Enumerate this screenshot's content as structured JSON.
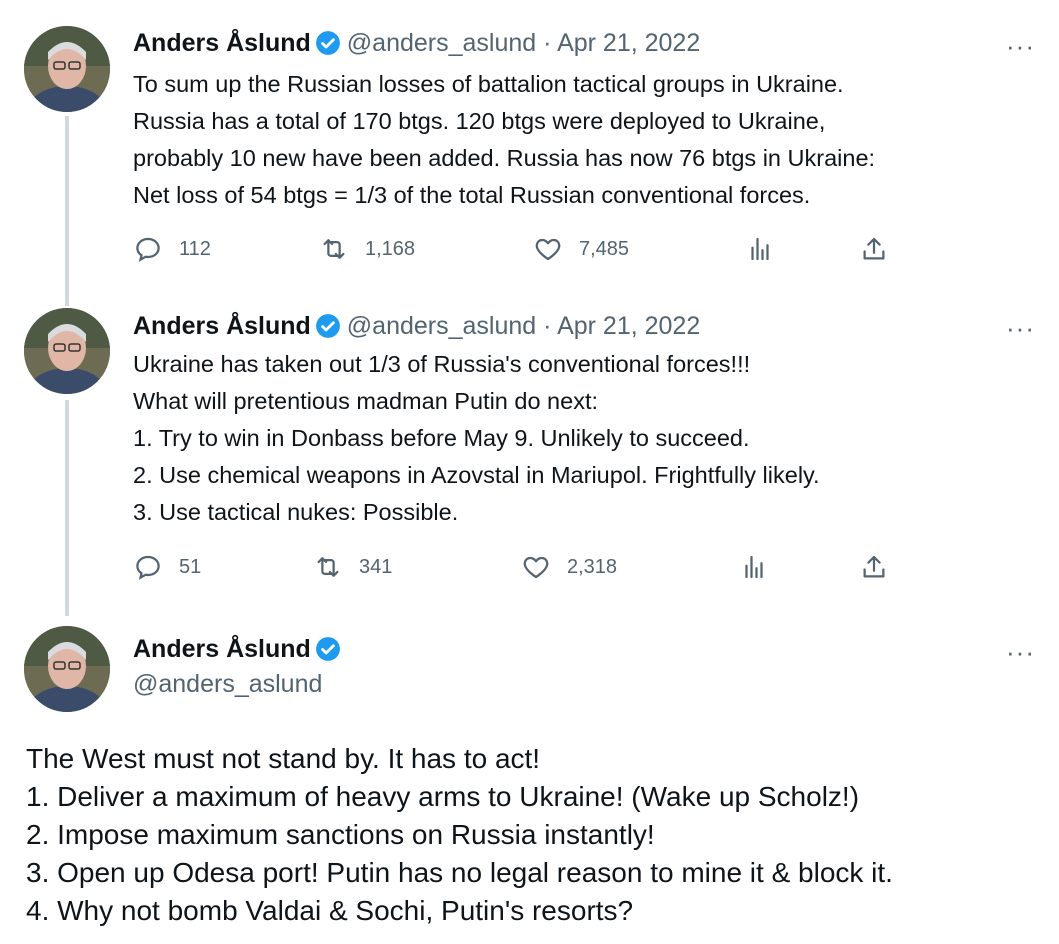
{
  "colors": {
    "text": "#0f1419",
    "secondary": "#536471",
    "verified": "#1d9bf0",
    "thread_line": "#cfd9de"
  },
  "tweets": [
    {
      "name": "Anders Åslund",
      "handle": "@anders_aslund",
      "separator": "·",
      "date": "Apr 21, 2022",
      "more": "···",
      "text": "To sum up the Russian losses of battalion tactical groups in Ukraine.\nRussia has a total of 170 btgs. 120 btgs were deployed to Ukraine,\nprobably 10 new have been added. Russia has now 76 btgs in Ukraine:\nNet loss of 54 btgs = 1/3 of the total Russian conventional forces.",
      "replies": "112",
      "retweets": "1,168",
      "likes": "7,485"
    },
    {
      "name": "Anders Åslund",
      "handle": "@anders_aslund",
      "separator": "·",
      "date": "Apr 21, 2022",
      "more": "···",
      "text": "Ukraine has taken out 1/3 of Russia's conventional forces!!!\nWhat will pretentious madman Putin do next:\n1. Try to win in Donbass before May 9. Unlikely to succeed.\n2. Use chemical weapons in Azovstal in Mariupol. Frightfully likely.\n3. Use tactical nukes: Possible.",
      "replies": "51",
      "retweets": "341",
      "likes": "2,318"
    },
    {
      "name": "Anders Åslund",
      "handle": "@anders_aslund",
      "more": "···",
      "text": "The West must not stand by. It has to act!\n1. Deliver a maximum of heavy arms to Ukraine! (Wake up Scholz!)\n2. Impose maximum sanctions on Russia instantly!\n3. Open up Odesa port! Putin has no legal reason to mine it & block it.\n4. Why not bomb Valdai & Sochi, Putin's resorts?"
    }
  ],
  "icons": {
    "reply": "reply-icon",
    "retweet": "retweet-icon",
    "like": "heart-icon",
    "views": "views-icon",
    "share": "share-icon",
    "verified": "verified-badge-icon"
  }
}
